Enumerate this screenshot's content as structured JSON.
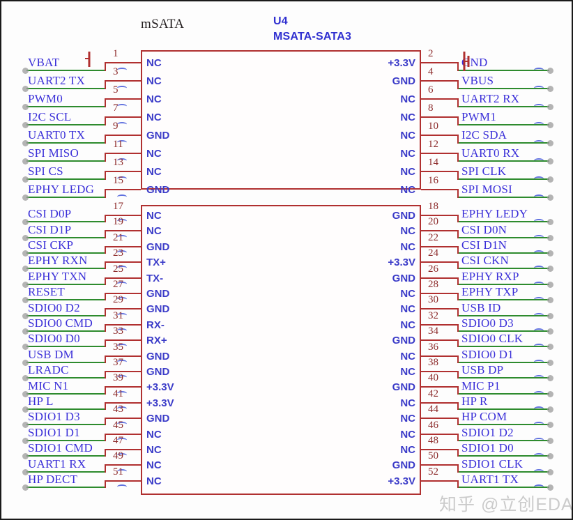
{
  "sheet": {
    "symbol_name": "mSATA",
    "designator": "U4",
    "part_number": "MSATA-SATA3",
    "watermark": "知乎 @立创EDA",
    "colors": {
      "outline": "#b03030",
      "pin_name": "#3b3bc8",
      "pin_number": "#8c2b2b",
      "net_label": "#3a2fd8",
      "wire_red": "#b03030",
      "wire_green": "#2e8b2e",
      "frame": "#1a1a1a"
    }
  },
  "top_box": {
    "left_pins": [
      {
        "num": "1",
        "name": "NC",
        "net": "VBAT"
      },
      {
        "num": "3",
        "name": "NC",
        "net": "UART2_TX"
      },
      {
        "num": "5",
        "name": "NC",
        "net": "PWM0"
      },
      {
        "num": "7",
        "name": "NC",
        "net": "I2C_SCL"
      },
      {
        "num": "9",
        "name": "GND",
        "net": "UART0_TX"
      },
      {
        "num": "11",
        "name": "NC",
        "net": "SPI_MISO"
      },
      {
        "num": "13",
        "name": "NC",
        "net": "SPI_CS"
      },
      {
        "num": "15",
        "name": "GND",
        "net": "EPHY_LEDG"
      }
    ],
    "right_pins": [
      {
        "num": "2",
        "name": "+3.3V",
        "net": "GND"
      },
      {
        "num": "4",
        "name": "GND",
        "net": "VBUS"
      },
      {
        "num": "6",
        "name": "NC",
        "net": "UART2_RX"
      },
      {
        "num": "8",
        "name": "NC",
        "net": "PWM1"
      },
      {
        "num": "10",
        "name": "NC",
        "net": "I2C_SDA"
      },
      {
        "num": "12",
        "name": "NC",
        "net": "UART0_RX"
      },
      {
        "num": "14",
        "name": "NC",
        "net": "SPI_CLK"
      },
      {
        "num": "16",
        "name": "NC",
        "net": "SPI_MOSI"
      }
    ]
  },
  "bottom_box": {
    "left_pins": [
      {
        "num": "17",
        "name": "NC",
        "net": "CSI_D0P"
      },
      {
        "num": "19",
        "name": "NC",
        "net": "CSI_D1P"
      },
      {
        "num": "21",
        "name": "GND",
        "net": "CSI_CKP"
      },
      {
        "num": "23",
        "name": "TX+",
        "net": "EPHY_RXN"
      },
      {
        "num": "25",
        "name": "TX-",
        "net": "EPHY_TXN"
      },
      {
        "num": "27",
        "name": "GND",
        "net": "RESET"
      },
      {
        "num": "29",
        "name": "GND",
        "net": "SDIO0_D2"
      },
      {
        "num": "31",
        "name": "RX-",
        "net": "SDIO0_CMD"
      },
      {
        "num": "33",
        "name": "RX+",
        "net": "SDIO0_D0"
      },
      {
        "num": "35",
        "name": "GND",
        "net": "USB_DM"
      },
      {
        "num": "37",
        "name": "GND",
        "net": "LRADC"
      },
      {
        "num": "39",
        "name": "+3.3V",
        "net": "MIC_N1"
      },
      {
        "num": "41",
        "name": "+3.3V",
        "net": "HP_L"
      },
      {
        "num": "43",
        "name": "GND",
        "net": "SDIO1_D3"
      },
      {
        "num": "45",
        "name": "NC",
        "net": "SDIO1_D1"
      },
      {
        "num": "47",
        "name": "NC",
        "net": "SDIO1_CMD"
      },
      {
        "num": "49",
        "name": "NC",
        "net": "UART1_RX"
      },
      {
        "num": "51",
        "name": "NC",
        "net": "HP_DECT"
      }
    ],
    "right_pins": [
      {
        "num": "18",
        "name": "GND",
        "net": "EPHY_LEDY"
      },
      {
        "num": "20",
        "name": "NC",
        "net": "CSI_D0N"
      },
      {
        "num": "22",
        "name": "NC",
        "net": "CSI_D1N"
      },
      {
        "num": "24",
        "name": "+3.3V",
        "net": "CSI_CKN"
      },
      {
        "num": "26",
        "name": "GND",
        "net": "EPHY_RXP"
      },
      {
        "num": "28",
        "name": "NC",
        "net": "EPHY_TXP"
      },
      {
        "num": "30",
        "name": "NC",
        "net": "USB_ID"
      },
      {
        "num": "32",
        "name": "NC",
        "net": "SDIO0_D3"
      },
      {
        "num": "34",
        "name": "GND",
        "net": "SDIO0_CLK"
      },
      {
        "num": "36",
        "name": "NC",
        "net": "SDIO0_D1"
      },
      {
        "num": "38",
        "name": "NC",
        "net": "USB_DP"
      },
      {
        "num": "40",
        "name": "GND",
        "net": "MIC_P1"
      },
      {
        "num": "42",
        "name": "NC",
        "net": "HP_R"
      },
      {
        "num": "44",
        "name": "NC",
        "net": "HP_COM"
      },
      {
        "num": "46",
        "name": "NC",
        "net": "SDIO1_D2"
      },
      {
        "num": "48",
        "name": "NC",
        "net": "SDIO1_D0"
      },
      {
        "num": "50",
        "name": "GND",
        "net": "SDIO1_CLK"
      },
      {
        "num": "52",
        "name": "+3.3V",
        "net": "UART1_TX"
      }
    ]
  }
}
